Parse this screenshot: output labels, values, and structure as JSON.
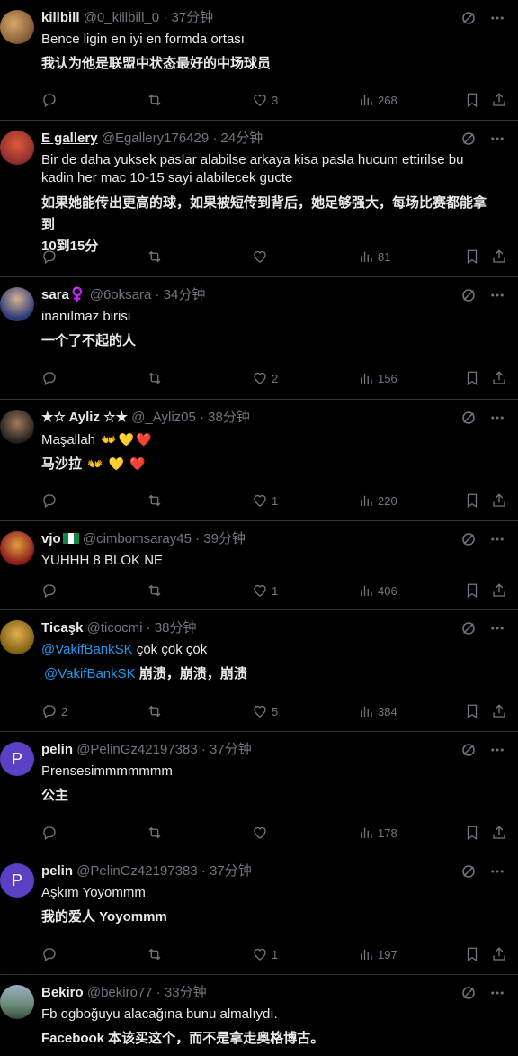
{
  "tweets": [
    {
      "name": "killbill",
      "handle": "@0_killbill_0 · 37分钟",
      "text": "Bence ligin en iyi en formda ortası",
      "translation": "我认为他是联盟中状态最好的中场球员",
      "replies": "",
      "retweets": "",
      "likes": "3",
      "views": "268",
      "avatar_color": "#7a5a3a"
    },
    {
      "name": "E gallery",
      "handle": "@Egallery176429 · 24分钟",
      "text_lines": [
        "Bir de daha yuksek paslar alabilse arkaya kisa pasla hucum ettirilse bu",
        "kadin her mac 10-15 sayi alabilecek gucte"
      ],
      "translation_lines": [
        "如果她能传出更高的球，如果被短传到背后，她足够强大，每场比赛都能拿到",
        "10到15分"
      ],
      "replies": "",
      "retweets": "",
      "likes": "",
      "views": "81",
      "avatar_color": "#b23a2a"
    },
    {
      "name": "sara♀️",
      "handle": "@6oksara · 34分钟",
      "text": "inanılmaz birisi",
      "translation": "一个了不起的人",
      "replies": "",
      "retweets": "",
      "likes": "2",
      "views": "156",
      "avatar_color": "#3a4a8a"
    },
    {
      "name": "★☆ Ayliz ☆★",
      "handle": "@_Ayliz05 · 38分钟",
      "text": "Maşallah",
      "translation": "马沙拉",
      "emojis": [
        "👐",
        "💛",
        "❤️"
      ],
      "replies": "",
      "retweets": "",
      "likes": "1",
      "views": "220",
      "avatar_color": "#4a3a2a"
    },
    {
      "name": "vjo",
      "handle": "@cimbomsaray45 · 39分钟",
      "text": "YUHHH 8 BLOK NE",
      "replies": "",
      "retweets": "",
      "likes": "1",
      "views": "406",
      "avatar_color": "#8a1a1a"
    },
    {
      "name": "Ticaşk",
      "handle": "@ticocmi · 38分钟",
      "mention": "@VakifBankSK",
      "text": " çök çök çök",
      "translation": " 崩溃，崩溃，崩溃",
      "replies": "2",
      "retweets": "",
      "likes": "5",
      "views": "384",
      "avatar_color": "#c9a020"
    },
    {
      "name": "pelin",
      "handle": "@PelinGz42197383 · 37分钟",
      "text": "Prensesimmmmmmm",
      "translation": "公主",
      "replies": "",
      "retweets": "",
      "likes": "",
      "views": "178",
      "avatar_color": "#5b3fc4",
      "avatar_letter": "P"
    },
    {
      "name": "pelin",
      "handle": "@PelinGz42197383 · 37分钟",
      "text": "Aşkım Yoyommm",
      "translation": "我的爱人 Yoyommm",
      "replies": "",
      "retweets": "",
      "likes": "1",
      "views": "197",
      "avatar_color": "#5b3fc4",
      "avatar_letter": "P"
    },
    {
      "name": "Bekiro",
      "handle": "@bekiro77 · 33分钟",
      "text": "Fb ogboğuyu alacağına bunu almalıydı.",
      "translation": "Facebook 本该买这个，而不是拿走奥格博古。",
      "avatar_color": "#5a7a6a"
    }
  ]
}
